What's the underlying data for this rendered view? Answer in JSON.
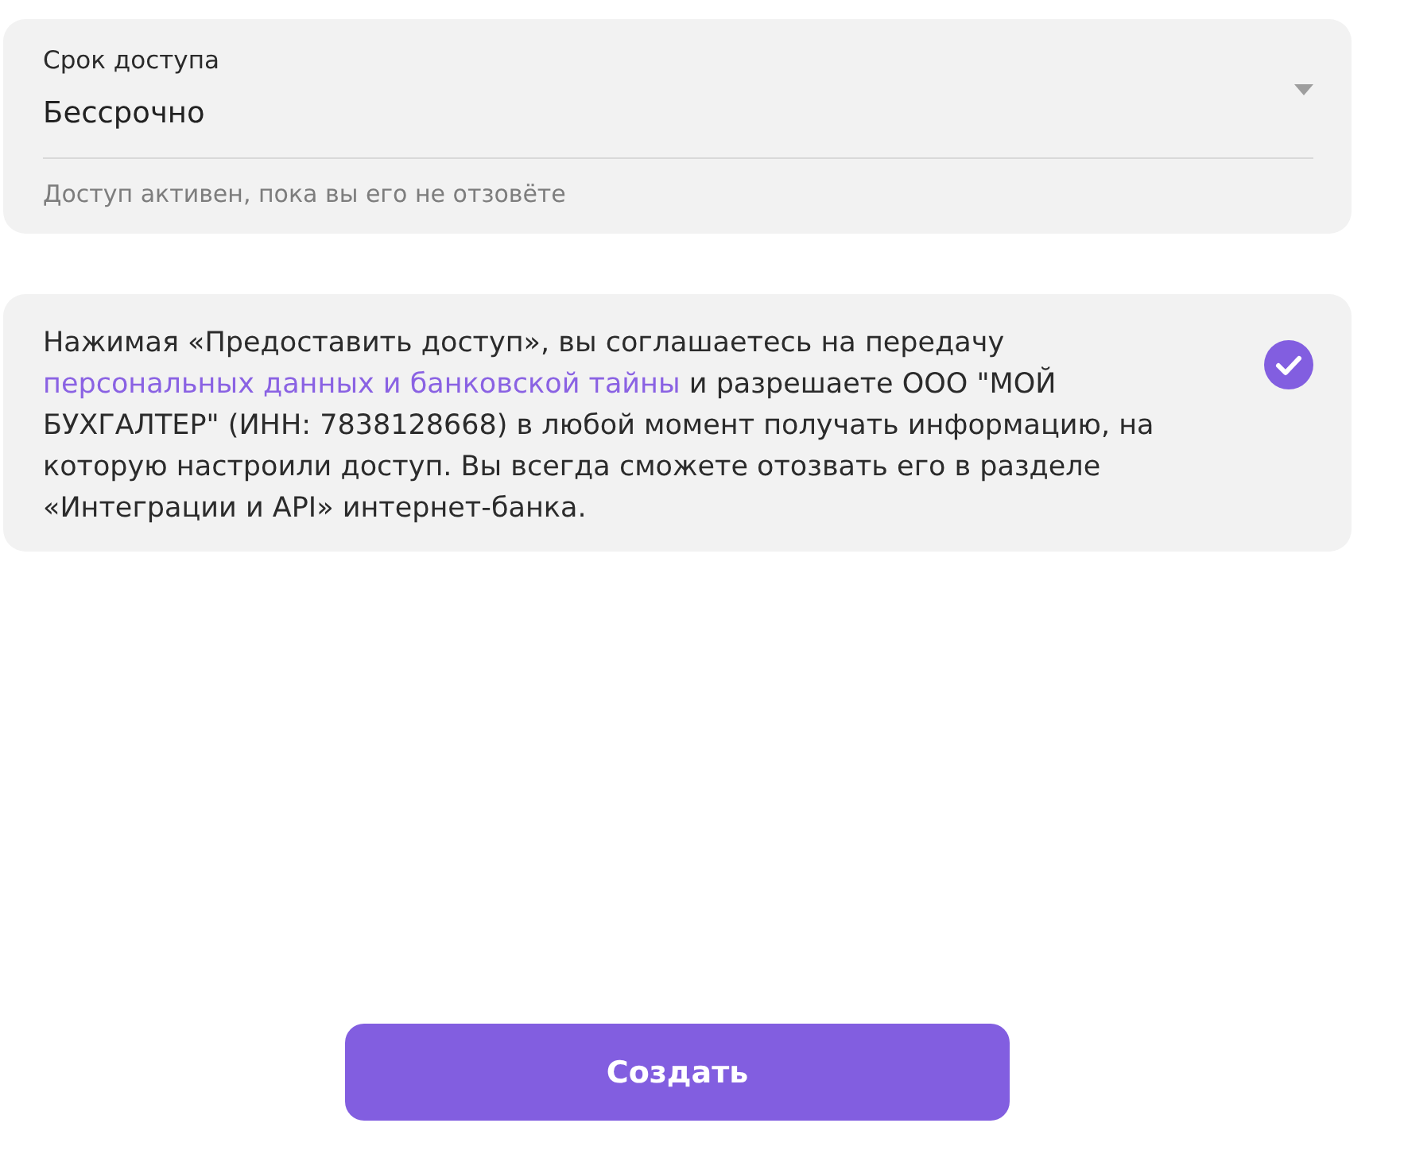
{
  "access_period": {
    "label": "Срок доступа",
    "value": "Бессрочно",
    "hint": "Доступ активен, пока вы его не отзовёте"
  },
  "consent": {
    "text_before": "Нажимая «Предоставить доступ», вы соглашаетесь на передачу",
    "link": "персональных данных и банковской тайны",
    "text_after": "и разрешаете ООО \"МОЙ БУХГАЛТЕР\" (ИНН: 7838128668) в любой момент получать информацию, на которую настроили доступ. Вы всегда сможете отозвать его в разделе «Интеграции и API» интернет-банка.",
    "checked": true
  },
  "submit_button": {
    "label": "Создать"
  }
}
